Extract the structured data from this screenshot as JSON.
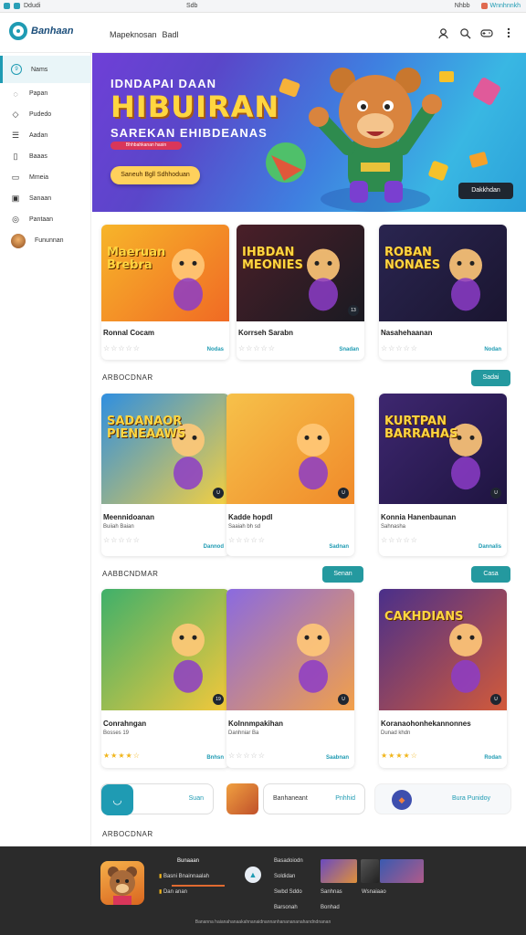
{
  "status": {
    "left_text": "Ddudi",
    "center_text": "Sdb",
    "right_text_1": "Nhbb",
    "right_text_2": "Wnnhnnkh"
  },
  "header": {
    "logo_text": "Banhaan",
    "nav_1": "Mapeknosan",
    "nav_2": "Badl",
    "icons": [
      "user-icon",
      "search-icon",
      "gamepad-icon",
      "more-icon"
    ]
  },
  "sidebar": {
    "items": [
      {
        "label": "Nams",
        "icon": "home-icon"
      },
      {
        "label": "Papan",
        "icon": "chat-icon"
      },
      {
        "label": "Pudedo",
        "icon": "tag-icon"
      },
      {
        "label": "Aadan",
        "icon": "list-icon"
      },
      {
        "label": "Baaas",
        "icon": "document-icon"
      },
      {
        "label": "Mmeia",
        "icon": "monitor-icon"
      },
      {
        "label": "Sanaan",
        "icon": "image-icon"
      },
      {
        "label": "Pantaan",
        "icon": "globe-icon"
      },
      {
        "label": "Fununnan",
        "icon": "avatar"
      }
    ]
  },
  "hero": {
    "small_title": "IDNDAPAI DAAN",
    "title": "HIBUIRAN",
    "subtitle": "SAREKAN EHIBDEANAS",
    "pill": "Bhhbahkanan hasin",
    "button": "Saneuh Bgll Sdhhoduan",
    "button_right": "Dakkhdan"
  },
  "row1": [
    {
      "thumb_title": "Maeruan\nBrebra",
      "title": "Ronnal Cocam",
      "link": "Nodas",
      "rating": 0,
      "colors": [
        "#f7b52a",
        "#f06a24"
      ]
    },
    {
      "thumb_title": "IHBDAN\nMEONIES",
      "title": "Korrseh Sarabn",
      "link": "Snadan",
      "rating": 0,
      "badge": "13",
      "colors": [
        "#4a1f28",
        "#1a1a22"
      ]
    },
    {
      "thumb_title": "ROBAN\nNONAES",
      "title": "Nasahehaanan",
      "link": "Nodan",
      "rating": 0,
      "colors": [
        "#2a2550",
        "#1a1530"
      ]
    }
  ],
  "section1": {
    "heading": "ARBOCDNAR",
    "button": "Sadai"
  },
  "row2": [
    {
      "thumb_title": "SADANAOR\nPIENEAAWS",
      "title": "Meennidoanan",
      "subtitle": "Buiiah Baian",
      "link": "Dannod",
      "rating": 0,
      "badge": "U",
      "colors": [
        "#2f8fe0",
        "#f5d040"
      ]
    },
    {
      "thumb_title": "",
      "title": "Kadde hopdl",
      "subtitle": "Saaiah bh sd",
      "link": "Sadnan",
      "rating": 0,
      "badge": "U",
      "colors": [
        "#f6c14a",
        "#f08a2a"
      ]
    },
    {
      "thumb_title": "KURTPAN\nBARRAHAS",
      "title": "Konnia Hanenbaunan",
      "subtitle": "Sahnasha",
      "link": "Dannalis",
      "rating": 0,
      "badge": "U",
      "colors": [
        "#3e2770",
        "#1e1440"
      ]
    }
  ],
  "section2": {
    "heading": "AABBCNDMAR",
    "button_1": "Senan",
    "button_2": "Casa"
  },
  "row3": [
    {
      "thumb_title": "",
      "title": "Conrahngan",
      "subtitle": "Bosses 19",
      "link": "Bnhsn",
      "rating": 4,
      "badge": "19",
      "colors": [
        "#3fb06a",
        "#f5c83a"
      ]
    },
    {
      "thumb_title": "",
      "title": "Kolnnmpakihan",
      "subtitle": "Danhniar Ba",
      "link": "Saabnan",
      "rating": 0,
      "badge": "U",
      "colors": [
        "#8a6ae0",
        "#f2a04a"
      ]
    },
    {
      "thumb_title": "CAKHDIANS",
      "title": "Koranaohonhekannonnes",
      "subtitle": "Dunad khdn",
      "link": "Rodan",
      "rating": 4,
      "badge": "U",
      "colors": [
        "#4a2f8a",
        "#d25a3a"
      ]
    }
  ],
  "bottom": {
    "pill1_label": "Suan",
    "pill2_label": "Banhaneant",
    "pill2_link": "Pnhhid",
    "pill3_label": "Bura Punidoy",
    "heading": "ARBOCDNAR"
  },
  "footer": {
    "col1_head": "Bunaaan",
    "col1_items": [
      "Basni Bnainnaalah",
      "Dan anan"
    ],
    "col2_items": [
      "Basadoiodn",
      "Soldidan",
      "Swbd Sddo",
      "Barsonah"
    ],
    "col3_items": [
      "Sanhnas",
      "Bonhad"
    ],
    "col4_item": "Wsnaiaao",
    "copyright": "Bananna haianahanaakahnanaidnannanhananananahandndnanan"
  },
  "colors": {
    "accent": "#1f9bb3",
    "teal_button": "#24999f",
    "footer_bg": "#2b2b2b",
    "star": "#f1b51a"
  }
}
